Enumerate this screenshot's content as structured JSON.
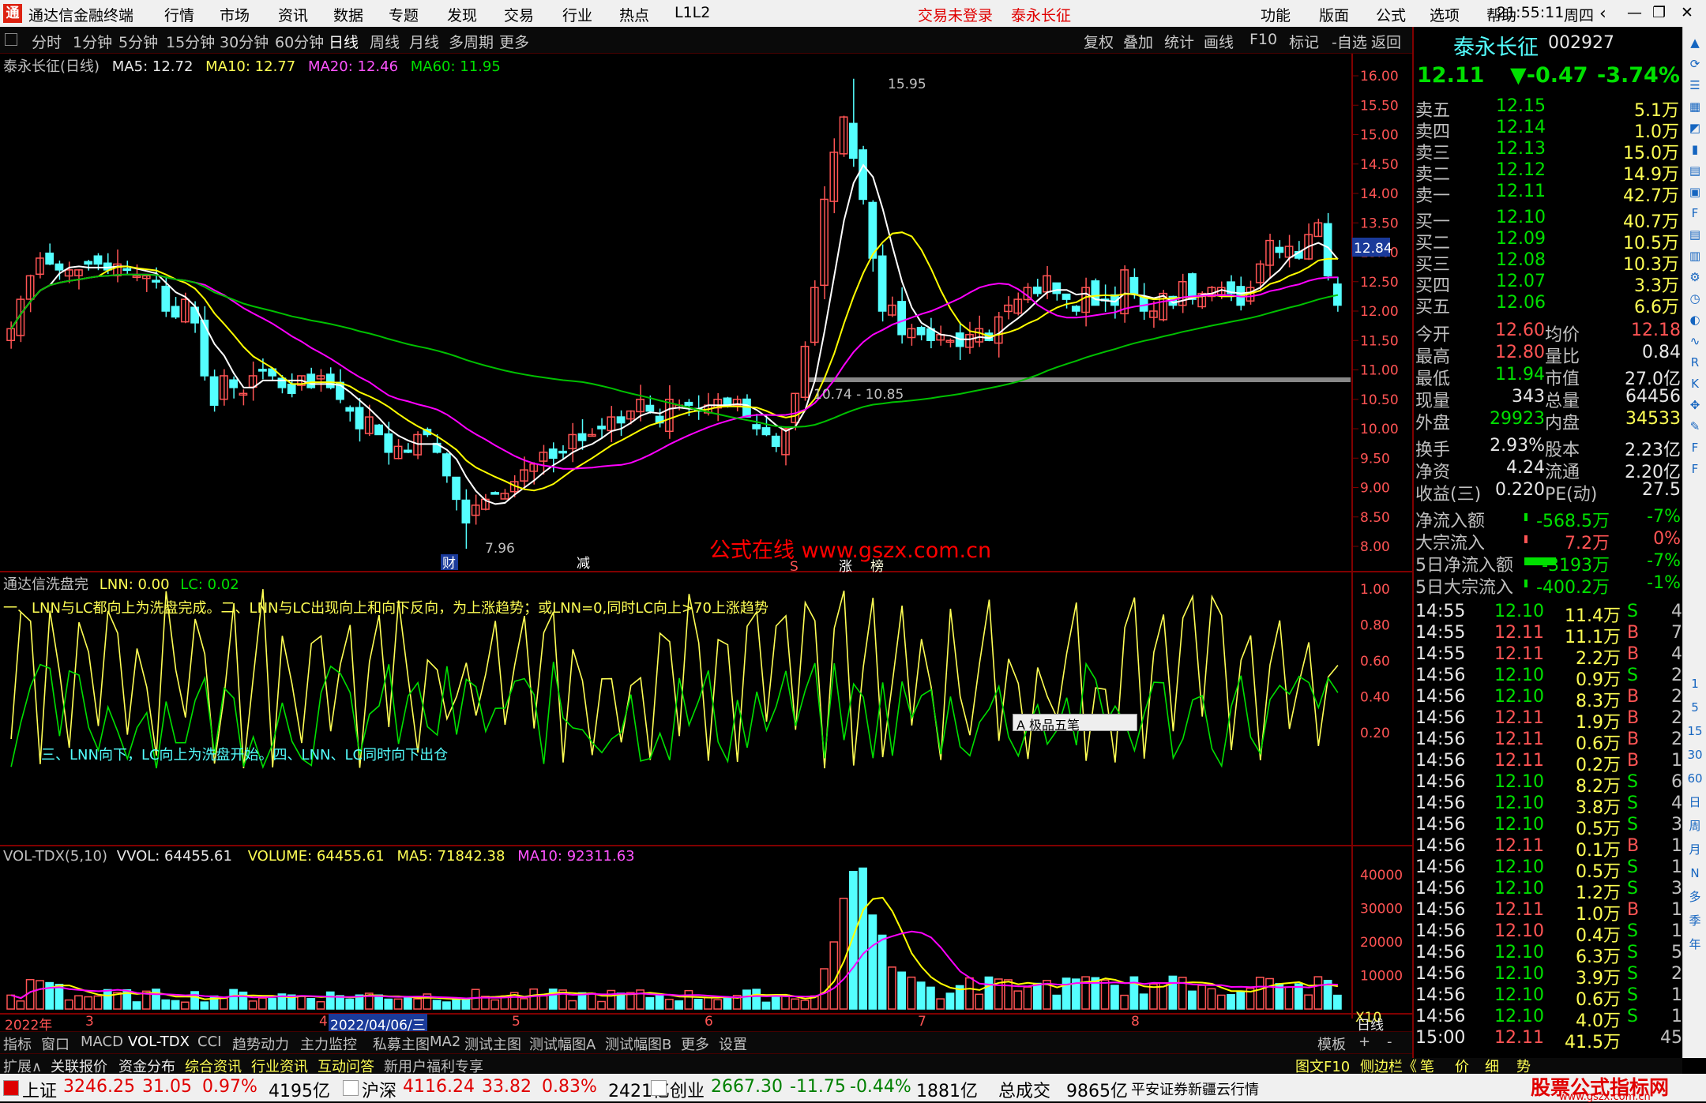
{
  "app": {
    "title": "通达信金融终端",
    "menu": [
      "行情",
      "市场",
      "资讯",
      "数据",
      "专题",
      "发现",
      "交易",
      "行业",
      "热点",
      "L1L2"
    ],
    "login_status": "交易未登录",
    "stock_title": "泰永长征",
    "right_menu": [
      "功能",
      "版面",
      "公式",
      "选项",
      "帮助"
    ],
    "time": "21:55:11",
    "weekday": "周四"
  },
  "toolbar": {
    "periods": [
      "分时",
      "1分钟",
      "5分钟",
      "15分钟",
      "30分钟",
      "60分钟",
      "日线",
      "周线",
      "月线",
      "多周期",
      "更多"
    ],
    "selected": "日线",
    "actions": [
      "复权",
      "叠加",
      "统计",
      "画线",
      "F10",
      "标记",
      "-自选",
      "返回"
    ]
  },
  "main_panel": {
    "title": "泰永长征(日线)",
    "ma5": "MA5: 12.72",
    "ma10": "MA10: 12.77",
    "ma20": "MA20: 12.46",
    "ma60": "MA60: 11.95",
    "high_label": "15.95",
    "low_label": "7.96",
    "range_label": "10.74 - 10.85",
    "watermark": "公式在线 www.gszx.com.cn",
    "markers": [
      "财",
      "减",
      "S",
      "涨",
      "榜"
    ],
    "y_ticks": [
      "16.00",
      "15.50",
      "15.00",
      "14.50",
      "14.00",
      "13.50",
      "13.00",
      "12.50",
      "12.00",
      "11.50",
      "11.00",
      "10.50",
      "10.00",
      "9.50",
      "9.00",
      "8.50",
      "8.00"
    ],
    "current_price_tag": "12.84"
  },
  "indicator_panel": {
    "title": "通达信洗盘完",
    "lnn": "LNN: 0.00",
    "lc": "LC: 0.02",
    "note1": "一、LNN与LC都向上为洗盘完成。二、LNN与LC出现向上和向下反向，为上涨趋势；或LNN=0,同时LC向上>70上涨趋势",
    "note2": "三、LNN向下，LC向上为洗盘开始。四、LNN、LC同时向下出仓",
    "y_ticks": [
      "1.00",
      "0.80",
      "0.60",
      "0.40",
      "0.20"
    ],
    "ime_bar": "极品五笔"
  },
  "volume_panel": {
    "title": "VOL-TDX(5,10)",
    "vvol": "VVOL: 64455.61",
    "volume": "VOLUME: 64455.61",
    "ma5": "MA5: 71842.38",
    "ma10": "MA10: 92311.63",
    "y_ticks": [
      "40000",
      "30000",
      "20000",
      "10000"
    ],
    "unit": "X10"
  },
  "x_axis": {
    "labels": [
      "2022年",
      "3",
      "4",
      "2022/04/06/三",
      "5",
      "6",
      "7",
      "8"
    ],
    "period": "日线"
  },
  "tabs_row1": [
    "指标",
    "窗口",
    "MACD",
    "VOL-TDX",
    "CCI",
    "趋势动力",
    "主力监控",
    "私募主图",
    "MA2",
    "测试主图",
    "测试幅图A",
    "测试幅图B",
    "更多",
    "设置"
  ],
  "tabs_row1_right": [
    "模板",
    "+",
    "-"
  ],
  "tabs_row2": [
    "扩展∧",
    "关联报价",
    "资金分布",
    "综合资讯",
    "行业资讯",
    "互动问答",
    "新用户福利专享"
  ],
  "tabs_row2_right": [
    "图文F10",
    "侧边栏《",
    "笔",
    "价",
    "细",
    "势"
  ],
  "quote": {
    "name": "泰永长征",
    "code": "002927",
    "price": "12.11",
    "change": "▼-0.47",
    "pct": "-3.74%",
    "asks": [
      {
        "label": "卖五",
        "p": "12.15",
        "v": "5.1万"
      },
      {
        "label": "卖四",
        "p": "12.14",
        "v": "1.0万"
      },
      {
        "label": "卖三",
        "p": "12.13",
        "v": "15.0万"
      },
      {
        "label": "卖二",
        "p": "12.12",
        "v": "14.9万"
      },
      {
        "label": "卖一",
        "p": "12.11",
        "v": "42.7万"
      }
    ],
    "bids": [
      {
        "label": "买一",
        "p": "12.10",
        "v": "40.7万"
      },
      {
        "label": "买二",
        "p": "12.09",
        "v": "10.5万"
      },
      {
        "label": "买三",
        "p": "12.08",
        "v": "10.3万"
      },
      {
        "label": "买四",
        "p": "12.07",
        "v": "3.3万"
      },
      {
        "label": "买五",
        "p": "12.06",
        "v": "6.6万"
      }
    ],
    "stats": [
      [
        "今开",
        "12.60",
        "均价",
        "12.18"
      ],
      [
        "最高",
        "12.80",
        "量比",
        "0.84"
      ],
      [
        "最低",
        "11.94",
        "市值",
        "27.0亿"
      ],
      [
        "现量",
        "343",
        "总量",
        "64456"
      ],
      [
        "外盘",
        "29923",
        "内盘",
        "34533"
      ],
      [
        "换手",
        "2.93%",
        "股本",
        "2.23亿"
      ],
      [
        "净资",
        "4.24",
        "流通",
        "2.20亿"
      ],
      [
        "收益(三)",
        "0.220",
        "PE(动)",
        "27.5"
      ]
    ],
    "flows": [
      [
        "净流入额",
        "-568.5万",
        "-7%"
      ],
      [
        "大宗流入",
        "7.2万",
        "0%"
      ],
      [
        "5日净流入额",
        "-3193万",
        "-7%"
      ],
      [
        "5日大宗流入",
        "-400.2万",
        "-1%"
      ]
    ],
    "ticks": [
      [
        "14:55",
        "12.10",
        "11.4万",
        "S",
        "4"
      ],
      [
        "14:55",
        "12.11",
        "11.1万",
        "B",
        "7"
      ],
      [
        "14:55",
        "12.11",
        "2.2万",
        "B",
        "4"
      ],
      [
        "14:56",
        "12.10",
        "0.9万",
        "S",
        "2"
      ],
      [
        "14:56",
        "12.10",
        "8.3万",
        "B",
        "2"
      ],
      [
        "14:56",
        "12.11",
        "1.9万",
        "B",
        "2"
      ],
      [
        "14:56",
        "12.11",
        "0.6万",
        "B",
        "2"
      ],
      [
        "14:56",
        "12.11",
        "0.2万",
        "B",
        "1"
      ],
      [
        "14:56",
        "12.10",
        "8.2万",
        "S",
        "6"
      ],
      [
        "14:56",
        "12.10",
        "3.8万",
        "S",
        "4"
      ],
      [
        "14:56",
        "12.10",
        "0.5万",
        "S",
        "3"
      ],
      [
        "14:56",
        "12.11",
        "0.1万",
        "B",
        "1"
      ],
      [
        "14:56",
        "12.10",
        "0.5万",
        "S",
        "1"
      ],
      [
        "14:56",
        "12.10",
        "1.2万",
        "S",
        "3"
      ],
      [
        "14:56",
        "12.11",
        "1.0万",
        "B",
        "1"
      ],
      [
        "14:56",
        "12.10",
        "0.4万",
        "S",
        "1"
      ],
      [
        "14:56",
        "12.10",
        "6.3万",
        "S",
        "5"
      ],
      [
        "14:56",
        "12.10",
        "3.9万",
        "S",
        "2"
      ],
      [
        "14:56",
        "12.10",
        "0.6万",
        "S",
        "1"
      ],
      [
        "14:56",
        "12.10",
        "4.0万",
        "S",
        "1"
      ],
      [
        "15:00",
        "12.11",
        "41.5万",
        "",
        "45"
      ]
    ]
  },
  "statusbar": {
    "indices": [
      {
        "name": "上证",
        "value": "3246.25",
        "chg": "31.05",
        "pct": "0.97%",
        "amt": "4195亿"
      },
      {
        "name": "沪深",
        "value": "4116.24",
        "chg": "33.82",
        "pct": "0.83%",
        "amt": "2421亿"
      },
      {
        "name": "创业",
        "value": "2667.30",
        "chg": "-11.75",
        "pct": "-0.44%",
        "amt": "1881亿"
      }
    ],
    "total_label": "总成交",
    "total": "9865亿",
    "broker": "平安证券新疆云行情",
    "brand": "股票公式指标网",
    "brand_url": "www.gszx.com.cn"
  },
  "colors": {
    "up": "#ff5454",
    "down": "#54ffff",
    "ma5": "#ffffff",
    "ma10": "#ffff00",
    "ma20": "#ff00ff",
    "ma60": "#00c000",
    "grid": "#800000"
  },
  "sidebar_icons": [
    "up-icon",
    "refresh-icon",
    "list-icon",
    "grid-icon",
    "chart-icon",
    "bar-icon",
    "doc-icon",
    "news-icon",
    "f10-icon",
    "doc2-icon",
    "fund-icon",
    "gear-icon",
    "clock-icon",
    "globe-icon",
    "line-icon",
    "rsi-icon",
    "k-icon",
    "move-icon",
    "pen-icon",
    "fs-icon",
    "f2-icon",
    "1-icon",
    "5-icon",
    "15-icon",
    "30-icon",
    "60-icon",
    "day-icon",
    "week-icon",
    "month-icon",
    "n-icon",
    "multi-icon",
    "season-icon",
    "year-icon"
  ],
  "sidebar_labels": [
    "1",
    "5",
    "15",
    "30",
    "60",
    "日",
    "周",
    "月",
    "N",
    "多",
    "季",
    "年"
  ]
}
